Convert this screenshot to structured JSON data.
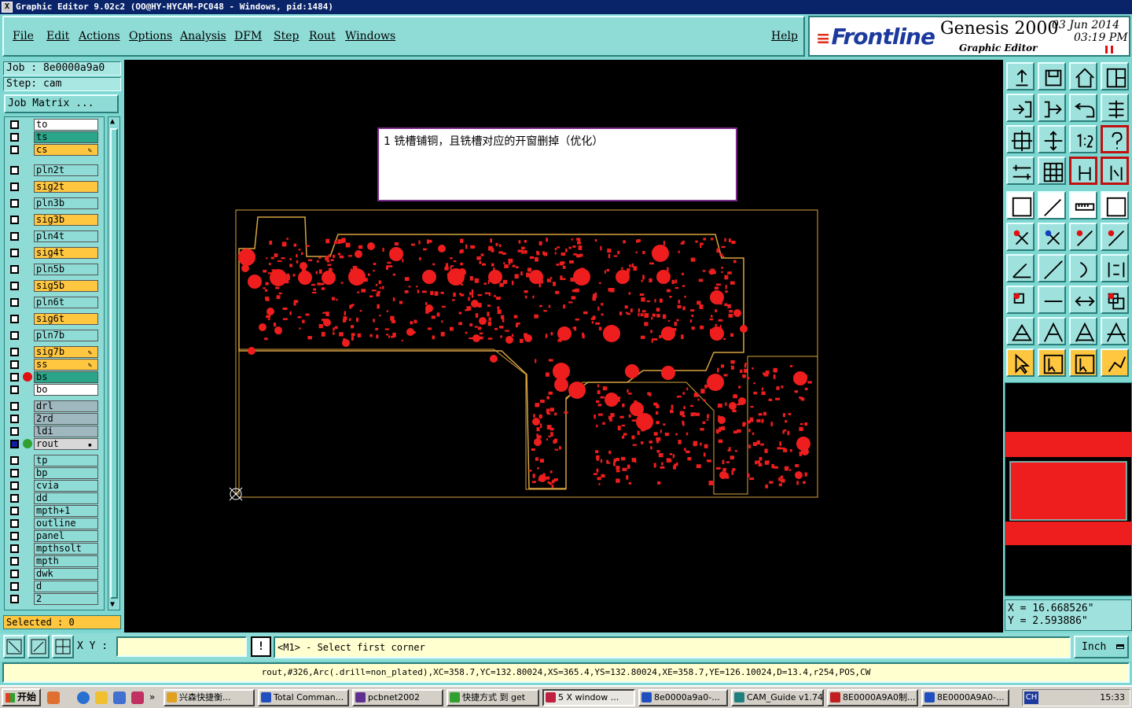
{
  "window": {
    "title": "Graphic Editor 9.02c2  (OO@HY-HYCAM-PC048 - Windows, pid:1484)",
    "app_icon": "X"
  },
  "menu": {
    "items": [
      "File",
      "Edit",
      "Actions",
      "Options",
      "Analysis",
      "DFM",
      "Step",
      "Rout",
      "Windows"
    ],
    "help": "Help"
  },
  "brand": {
    "logo": "Frontline",
    "product": "Genesis 2000",
    "subtitle": "Graphic Editor",
    "date": "03  Jun  2014",
    "time": "03:19  PM"
  },
  "job": {
    "job_label": "Job : 8e0000a9a0",
    "step_label": "Step: cam",
    "matrix_button": "Job Matrix ..."
  },
  "layers": [
    {
      "name": "to",
      "color": "#ffffff",
      "flag": ""
    },
    {
      "name": "ts",
      "color": "#2aa58a",
      "flag": ""
    },
    {
      "name": "cs",
      "color": "#ffc640",
      "flag": "✎"
    },
    {
      "name": "pln2t",
      "color": "#8fdcd7",
      "flag": ""
    },
    {
      "name": "sig2t",
      "color": "#ffc640",
      "flag": ""
    },
    {
      "name": "pln3b",
      "color": "#8fdcd7",
      "flag": ""
    },
    {
      "name": "sig3b",
      "color": "#ffc640",
      "flag": ""
    },
    {
      "name": "pln4t",
      "color": "#8fdcd7",
      "flag": ""
    },
    {
      "name": "sig4t",
      "color": "#ffc640",
      "flag": ""
    },
    {
      "name": "pln5b",
      "color": "#8fdcd7",
      "flag": ""
    },
    {
      "name": "sig5b",
      "color": "#ffc640",
      "flag": ""
    },
    {
      "name": "pln6t",
      "color": "#8fdcd7",
      "flag": ""
    },
    {
      "name": "sig6t",
      "color": "#ffc640",
      "flag": ""
    },
    {
      "name": "pln7b",
      "color": "#8fdcd7",
      "flag": ""
    },
    {
      "name": "sig7b",
      "color": "#ffc640",
      "flag": "✎"
    },
    {
      "name": "ss",
      "color": "#ffc640",
      "flag": "✎"
    },
    {
      "name": "bs",
      "color": "#2aa58a",
      "flag": "",
      "dot": "#e01010"
    },
    {
      "name": "bo",
      "color": "#ffffff",
      "flag": ""
    },
    {
      "name": "drl",
      "color": "#9fb8c0",
      "flag": ""
    },
    {
      "name": "2rd",
      "color": "#9fb8c0",
      "flag": ""
    },
    {
      "name": "ldi",
      "color": "#9fb8c0",
      "flag": ""
    },
    {
      "name": "rout",
      "color": "#d8d8d8",
      "flag": "▪",
      "dot": "#30a030",
      "active": true
    },
    {
      "name": "tp",
      "color": "#8fdcd7",
      "flag": ""
    },
    {
      "name": "bp",
      "color": "#8fdcd7",
      "flag": ""
    },
    {
      "name": "cvia",
      "color": "#8fdcd7",
      "flag": ""
    },
    {
      "name": "dd",
      "color": "#8fdcd7",
      "flag": ""
    },
    {
      "name": "mpth+1",
      "color": "#8fdcd7",
      "flag": ""
    },
    {
      "name": "outline",
      "color": "#8fdcd7",
      "flag": ""
    },
    {
      "name": "panel",
      "color": "#8fdcd7",
      "flag": ""
    },
    {
      "name": "mpthsolt",
      "color": "#8fdcd7",
      "flag": ""
    },
    {
      "name": "mpth",
      "color": "#8fdcd7",
      "flag": ""
    },
    {
      "name": "dwk",
      "color": "#8fdcd7",
      "flag": ""
    },
    {
      "name": "d",
      "color": "#8fdcd7",
      "flag": ""
    },
    {
      "name": "2",
      "color": "#8fdcd7",
      "flag": ""
    }
  ],
  "selected_label": "Selected : 0",
  "note": "1 铣槽铺铜，且铣槽对应的开窗删掉（优化）",
  "coords": {
    "x": "X  =  16.668526\"",
    "y": "Y  =  2.593886\""
  },
  "bottom": {
    "xy_label": "X Y :",
    "xy_value": "",
    "warn": "!",
    "prompt": "<M1> - Select first corner",
    "units": "Inch"
  },
  "status_line": "rout,#326,Arc(.drill=non_plated),XC=358.7,YC=132.80024,XS=365.4,YS=132.80024,XE=358.7,YE=126.10024,D=13.4,r254,POS,CW",
  "taskbar": {
    "start": "开始",
    "tasks": [
      {
        "label": "兴森快捷衡...",
        "icon": "#e0a020"
      },
      {
        "label": "Total Comman...",
        "icon": "#2050c0"
      },
      {
        "label": "pcbnet2002",
        "icon": "#603090"
      },
      {
        "label": "快捷方式 到 get",
        "icon": "#30a030"
      },
      {
        "label": "5 X window ...",
        "icon": "#c02040",
        "active": true
      },
      {
        "label": "8e0000a9a0-...",
        "icon": "#2050c0"
      },
      {
        "label": "CAM_Guide v1.74",
        "icon": "#208080"
      },
      {
        "label": "8E0000A9A0制...",
        "icon": "#c02020"
      },
      {
        "label": "8E0000A9A0-...",
        "icon": "#2050c0"
      }
    ],
    "tray_lang": "CH",
    "clock": "15:33"
  }
}
